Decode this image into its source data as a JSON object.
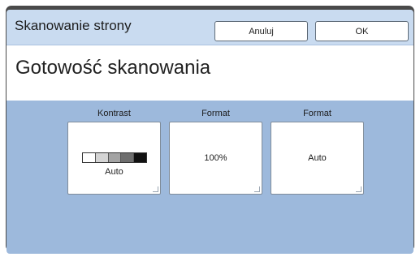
{
  "header": {
    "title": "Skanowanie strony",
    "cancel_label": "Anuluj",
    "ok_label": "OK"
  },
  "status": {
    "text": "Gotowość skanowania"
  },
  "cards": [
    {
      "label": "Kontrast",
      "value": "Auto",
      "scale_colors": [
        "#ffffff",
        "#d4d4d4",
        "#a3a3a3",
        "#6e6e6e",
        "#111111"
      ]
    },
    {
      "label": "Format",
      "value": "100%"
    },
    {
      "label": "Format",
      "value": "Auto"
    }
  ],
  "colors": {
    "header_bg": "#c9dbf0",
    "panel_bg": "#9db9dc",
    "frame": "#4a4a4a"
  }
}
